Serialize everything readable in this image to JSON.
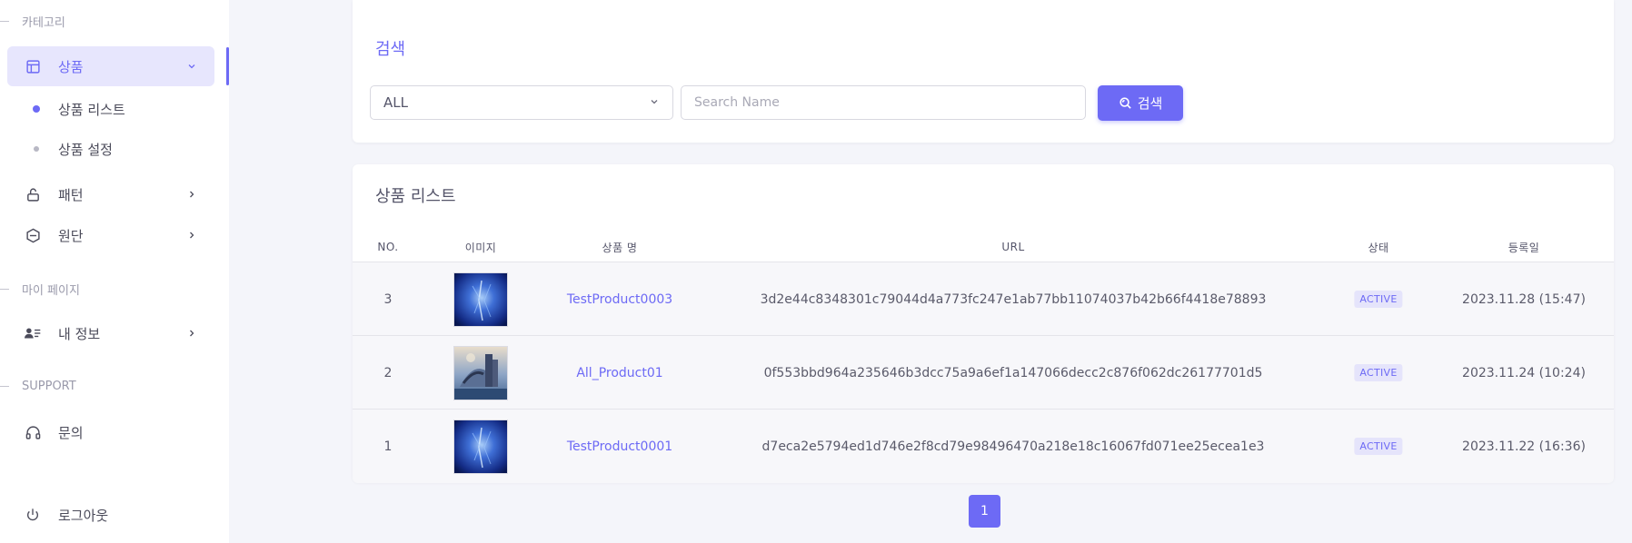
{
  "sidebar": {
    "sections": {
      "category": "카테고리",
      "mypage": "마이 페이지",
      "support": "SUPPORT"
    },
    "products": {
      "label": "상품",
      "icon": "layout-icon"
    },
    "sub_items": [
      {
        "label": "상품 리스트"
      },
      {
        "label": "상품 설정"
      }
    ],
    "pattern": {
      "label": "패턴",
      "icon": "lock-icon"
    },
    "fabric": {
      "label": "원단",
      "icon": "hexagon-icon"
    },
    "my_info": {
      "label": "내 정보",
      "icon": "user-list-icon"
    },
    "inquiry": {
      "label": "문의",
      "icon": "headset-icon"
    },
    "logout": {
      "label": "로그아웃",
      "icon": "power-icon"
    }
  },
  "search": {
    "title": "검색",
    "select_value": "ALL",
    "input_placeholder": "Search Name",
    "button_label": "검색"
  },
  "list": {
    "title": "상품 리스트",
    "columns": {
      "no": "NO.",
      "image": "이미지",
      "name": "상품 명",
      "url": "URL",
      "status": "상태",
      "date": "등록일"
    },
    "rows": [
      {
        "no": "3",
        "image": "product-thumbnail-blue",
        "name": "TestProduct0003",
        "url": "3d2e44c8348301c79044d4a773fc247e1ab77bb11074037b42b66f4418e78893",
        "status": "ACTIVE",
        "date": "2023.11.28 (15:47)"
      },
      {
        "no": "2",
        "image": "product-thumbnail-castle",
        "name": "All_Product01",
        "url": "0f553bbd964a235646b3dcc75a9a6ef1a147066decc2c876f062dc26177701d5",
        "status": "ACTIVE",
        "date": "2023.11.24 (10:24)"
      },
      {
        "no": "1",
        "image": "product-thumbnail-blue",
        "name": "TestProduct0001",
        "url": "d7eca2e5794ed1d746e2f8cd79e98496470a218e18c16067fd071ee25ecea1e3",
        "status": "ACTIVE",
        "date": "2023.11.22 (16:36)"
      }
    ]
  },
  "pagination": {
    "current": "1"
  },
  "colors": {
    "accent": "#6d6af5",
    "background": "#f4f5fa",
    "active_bg": "#e7e6fd"
  }
}
